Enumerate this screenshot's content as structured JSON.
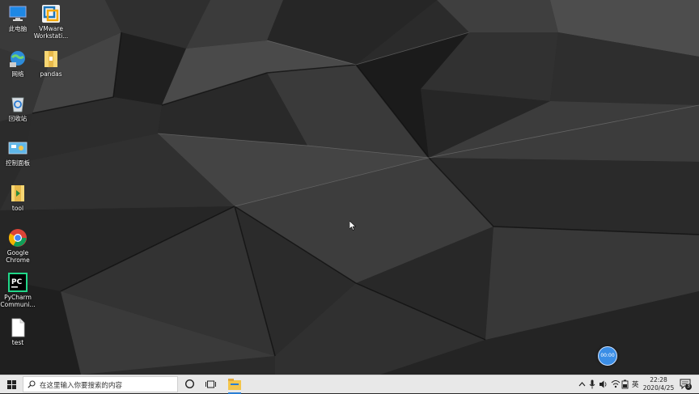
{
  "desktop": {
    "icons": [
      {
        "label": "此电脑"
      },
      {
        "label": "VMware Workstati..."
      },
      {
        "label": "网络"
      },
      {
        "label": "pandas"
      },
      {
        "label": "回收站"
      },
      {
        "label": "控制面板"
      },
      {
        "label": "tool"
      },
      {
        "label": "Google Chrome"
      },
      {
        "label": "PyCharm Communi..."
      },
      {
        "label": "test"
      }
    ]
  },
  "recorder": {
    "time": "00:00",
    "color": "#3b8ee6"
  },
  "taskbar": {
    "search_placeholder": "在这里输入你要搜索的内容",
    "ime": "英",
    "time": "22:28",
    "date": "2020/4/25",
    "notification_count": "3",
    "accent": "#2a7fd4"
  }
}
